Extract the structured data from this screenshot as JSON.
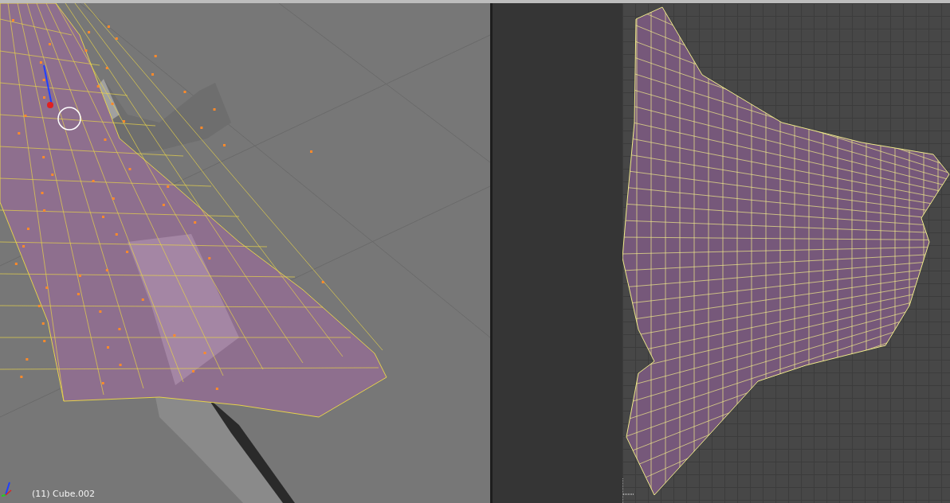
{
  "viewport": {
    "object_label": "(11) Cube.002"
  }
}
